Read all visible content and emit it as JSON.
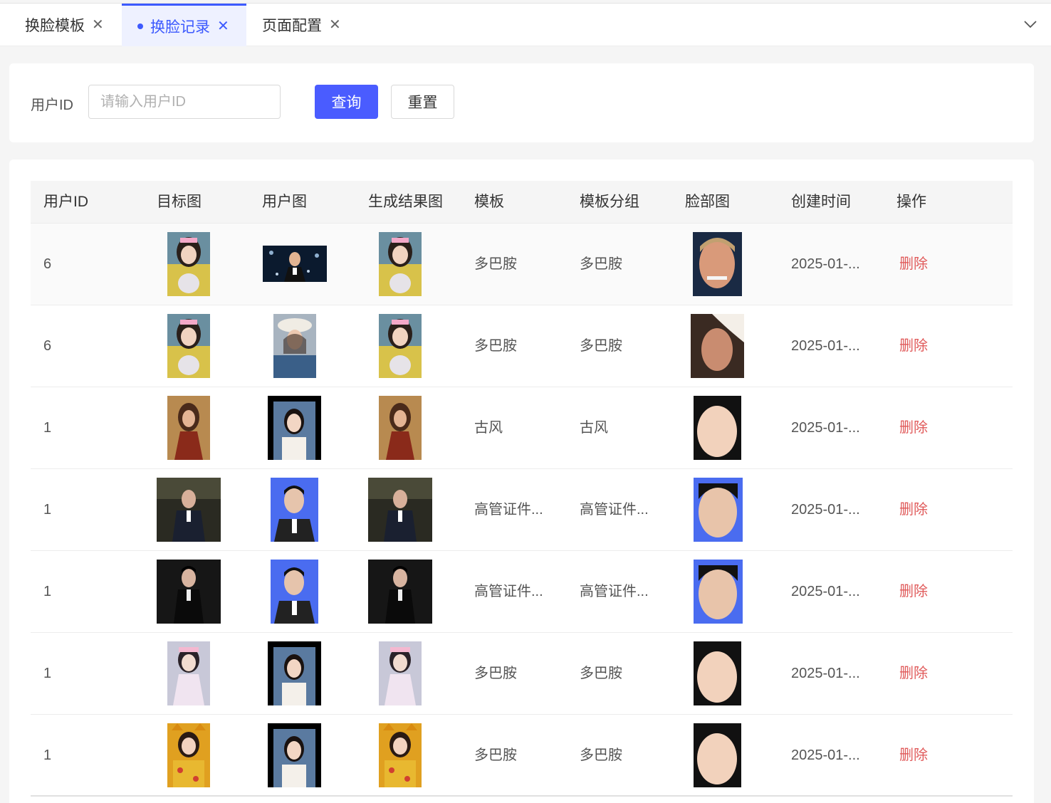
{
  "tabs": [
    {
      "label": "换脸模板",
      "active": false
    },
    {
      "label": "换脸记录",
      "active": true
    },
    {
      "label": "页面配置",
      "active": false
    }
  ],
  "search": {
    "label": "用户ID",
    "placeholder": "请输入用户ID",
    "query_label": "查询",
    "reset_label": "重置"
  },
  "table": {
    "columns": [
      "用户ID",
      "目标图",
      "用户图",
      "生成结果图",
      "模板",
      "模板分组",
      "脸部图",
      "创建时间",
      "操作"
    ],
    "rows": [
      {
        "user_id": "6",
        "template": "多巴胺",
        "group": "多巴胺",
        "created": "2025-01-...",
        "action": "删除"
      },
      {
        "user_id": "6",
        "template": "多巴胺",
        "group": "多巴胺",
        "created": "2025-01-...",
        "action": "删除"
      },
      {
        "user_id": "1",
        "template": "古风",
        "group": "古风",
        "created": "2025-01-...",
        "action": "删除"
      },
      {
        "user_id": "1",
        "template": "高管证件...",
        "group": "高管证件...",
        "created": "2025-01-...",
        "action": "删除"
      },
      {
        "user_id": "1",
        "template": "高管证件...",
        "group": "高管证件...",
        "created": "2025-01-...",
        "action": "删除"
      },
      {
        "user_id": "1",
        "template": "多巴胺",
        "group": "多巴胺",
        "created": "2025-01-...",
        "action": "删除"
      },
      {
        "user_id": "1",
        "template": "多巴胺",
        "group": "多巴胺",
        "created": "2025-01-...",
        "action": "删除"
      }
    ]
  },
  "colors": {
    "accent": "#4a5cff",
    "danger": "#e05a5a"
  }
}
